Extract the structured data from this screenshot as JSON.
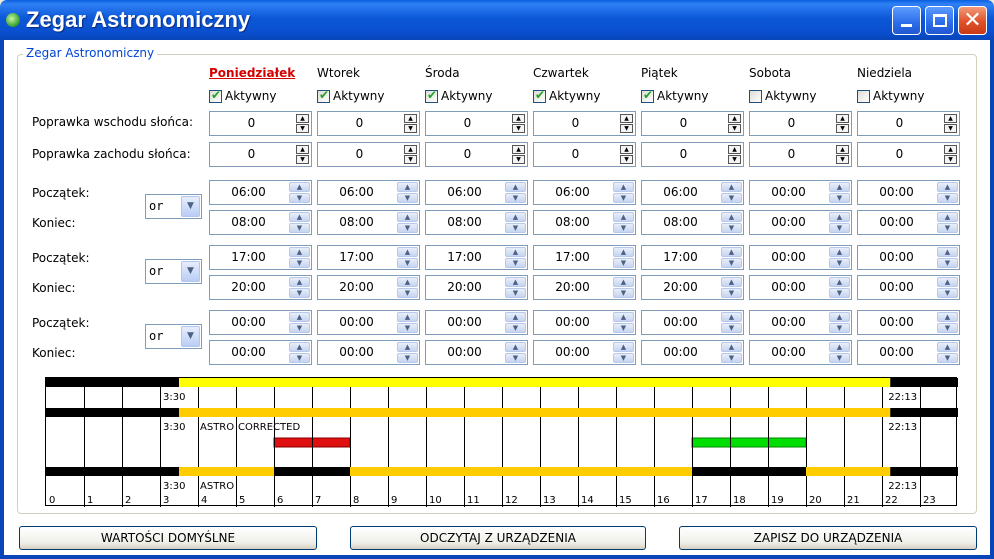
{
  "window": {
    "title": "Zegar Astronomiczny",
    "minimize_icon": "minimize-icon",
    "maximize_icon": "maximize-icon",
    "close_icon": "close-icon",
    "close_glyph": "✕"
  },
  "group": {
    "title": "Zegar Astronomiczny"
  },
  "labels": {
    "sunrise": "Poprawka wschodu słońca:",
    "sunset": "Poprawka zachodu słońca:",
    "start": "Początek:",
    "end": "Koniec:",
    "active": "Aktywny"
  },
  "days": [
    {
      "name": "Poniedziałek",
      "active": true,
      "sunrise": "0",
      "sunset": "0",
      "p1s": "06:00",
      "p1e": "08:00",
      "p2s": "17:00",
      "p2e": "20:00",
      "p3s": "00:00",
      "p3e": "00:00"
    },
    {
      "name": "Wtorek",
      "active": true,
      "sunrise": "0",
      "sunset": "0",
      "p1s": "06:00",
      "p1e": "08:00",
      "p2s": "17:00",
      "p2e": "20:00",
      "p3s": "00:00",
      "p3e": "00:00"
    },
    {
      "name": "Środa",
      "active": true,
      "sunrise": "0",
      "sunset": "0",
      "p1s": "06:00",
      "p1e": "08:00",
      "p2s": "17:00",
      "p2e": "20:00",
      "p3s": "00:00",
      "p3e": "00:00"
    },
    {
      "name": "Czwartek",
      "active": true,
      "sunrise": "0",
      "sunset": "0",
      "p1s": "06:00",
      "p1e": "08:00",
      "p2s": "17:00",
      "p2e": "20:00",
      "p3s": "00:00",
      "p3e": "00:00"
    },
    {
      "name": "Piątek",
      "active": true,
      "sunrise": "0",
      "sunset": "0",
      "p1s": "06:00",
      "p1e": "08:00",
      "p2s": "17:00",
      "p2e": "20:00",
      "p3s": "00:00",
      "p3e": "00:00"
    },
    {
      "name": "Sobota",
      "active": false,
      "sunrise": "0",
      "sunset": "0",
      "p1s": "00:00",
      "p1e": "00:00",
      "p2s": "00:00",
      "p2e": "00:00",
      "p3s": "00:00",
      "p3e": "00:00"
    },
    {
      "name": "Niedziela",
      "active": false,
      "sunrise": "0",
      "sunset": "0",
      "p1s": "00:00",
      "p1e": "00:00",
      "p2s": "00:00",
      "p2e": "00:00",
      "p3s": "00:00",
      "p3e": "00:00"
    }
  ],
  "operators": [
    "or",
    "or",
    "or"
  ],
  "timeline": {
    "hours": [
      "0",
      "1",
      "2",
      "3",
      "4",
      "5",
      "6",
      "7",
      "8",
      "9",
      "10",
      "11",
      "12",
      "13",
      "14",
      "15",
      "16",
      "17",
      "18",
      "19",
      "20",
      "21",
      "22",
      "23"
    ],
    "sunrise_label": "3:30",
    "sunset_label": "22:13",
    "sunrise_hour": 3.5,
    "sunset_hour": 22.217,
    "row2_labels": [
      "ASTRO",
      "CORRECTED"
    ],
    "row3_label": "ASTRO",
    "red_period": [
      6,
      8
    ],
    "green_period": [
      17,
      20
    ],
    "colors": {
      "black": "#000000",
      "yellow": "#ffff00",
      "gold": "#ffcc00",
      "red": "#e01010",
      "green": "#00dd00"
    }
  },
  "buttons": {
    "defaults": "WARTOŚCI DOMYŚLNE",
    "read": "ODCZYTAJ Z URZĄDZENIA",
    "write": "ZAPISZ DO URZĄDZENIA"
  }
}
